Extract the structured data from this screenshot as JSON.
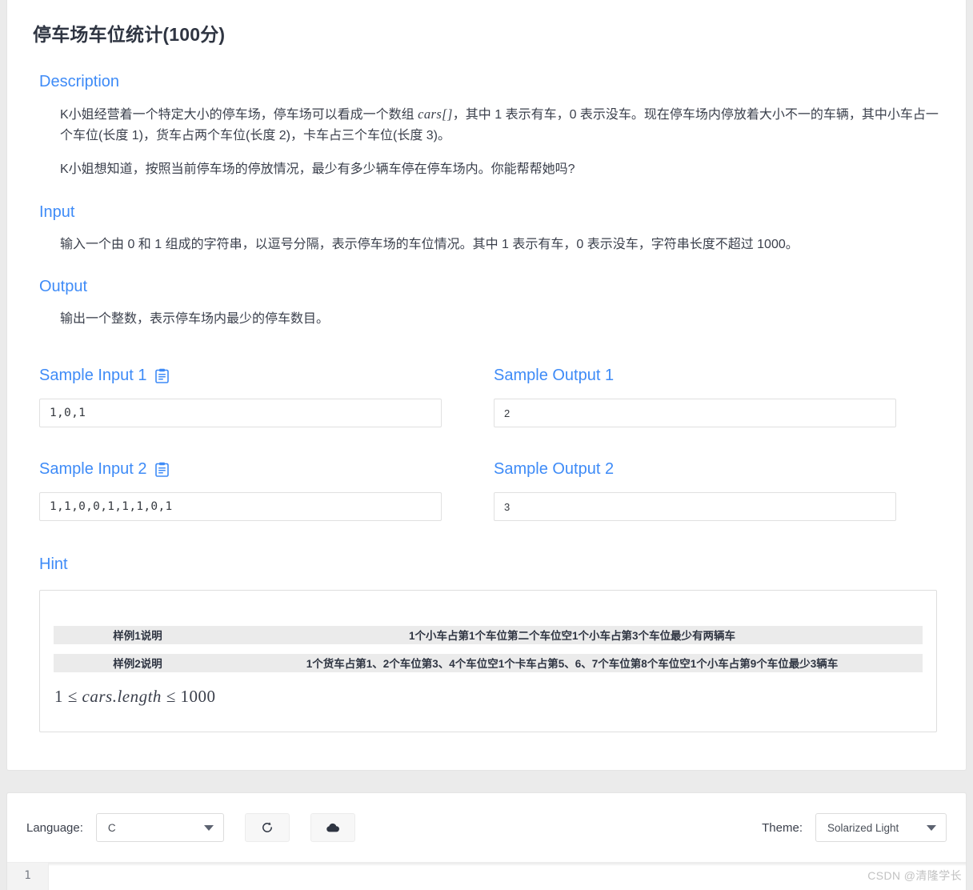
{
  "page": {
    "title": "停车场车位统计(100分)",
    "watermark": "CSDN @清隆学长",
    "accent_color": "#3e8bf7",
    "title_color": "#2f3542",
    "body_color": "#3a3f4b",
    "hint_row_bg": "#ebebeb",
    "page_bg": "#ebebeb"
  },
  "description": {
    "heading": "Description",
    "paragraph1_pre": "K小姐经营着一个特定大小的停车场，停车场可以看成一个数组 ",
    "paragraph1_math": "cars[]",
    "paragraph1_post": "，其中 1 表示有车，0 表示没车。现在停车场内停放着大小不一的车辆，其中小车占一个车位(长度 1)，货车占两个车位(长度 2)，卡车占三个车位(长度 3)。",
    "paragraph2": "K小姐想知道，按照当前停车场的停放情况，最少有多少辆车停在停车场内。你能帮帮她吗?"
  },
  "input": {
    "heading": "Input",
    "paragraph": "输入一个由 0 和 1 组成的字符串，以逗号分隔，表示停车场的车位情况。其中 1 表示有车，0 表示没车，字符串长度不超过 1000。"
  },
  "output": {
    "heading": "Output",
    "paragraph": "输出一个整数，表示停车场内最少的停车数目。"
  },
  "samples": [
    {
      "input_heading": "Sample Input 1",
      "input_value": "1,0,1",
      "output_heading": "Sample Output 1",
      "output_value": "2",
      "copy_icon": "clipboard-copy-icon"
    },
    {
      "input_heading": "Sample Input 2",
      "input_value": "1,1,0,0,1,1,1,0,1",
      "output_heading": "Sample Output 2",
      "output_value": "3",
      "copy_icon": "clipboard-copy-icon"
    }
  ],
  "hint": {
    "heading": "Hint",
    "rows": [
      {
        "label": "样例1说明",
        "value": "1个小车占第1个车位第二个车位空1个小车占第3个车位最少有两辆车"
      },
      {
        "label": "样例2说明",
        "value": "1个货车占第1、2个车位第3、4个车位空1个卡车占第5、6、7个车位第8个车位空1个小车占第9个车位最少3辆车"
      }
    ],
    "constraint_lower": "1",
    "constraint_le1": "≤",
    "constraint_var": "cars.length",
    "constraint_le2": "≤",
    "constraint_upper": "1000"
  },
  "editor": {
    "language_label": "Language:",
    "language_value": "C",
    "theme_label": "Theme:",
    "theme_value": "Solarized Light",
    "reset_button_icon": "refresh-icon",
    "submit_button_icon": "cloud-upload-icon",
    "first_line_number": "1",
    "code_value": ""
  }
}
